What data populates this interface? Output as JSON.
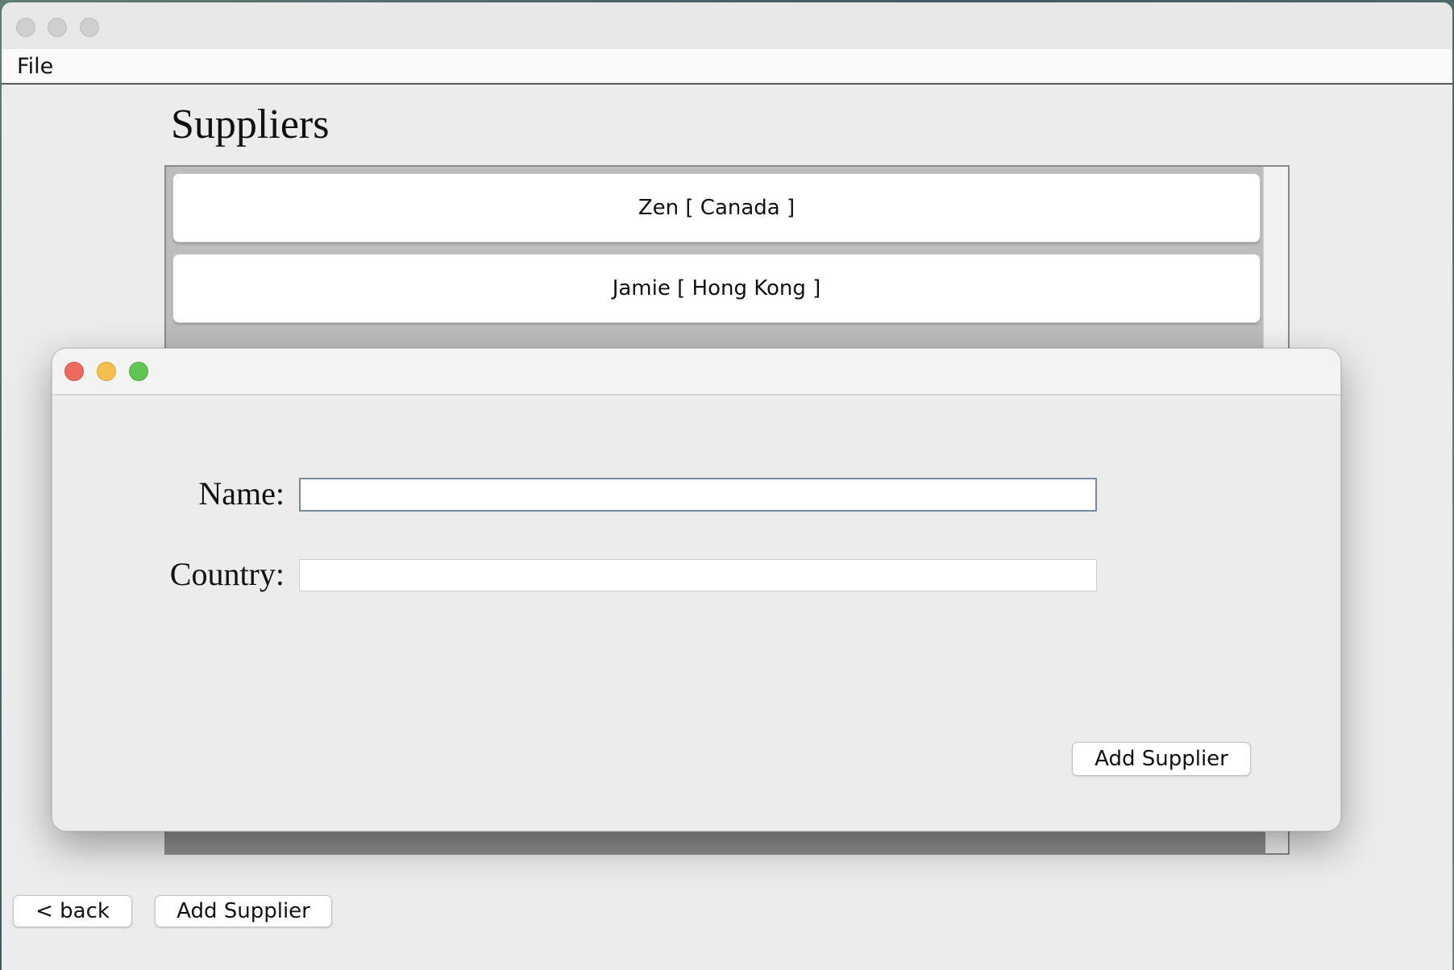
{
  "menu": {
    "file_label": "File"
  },
  "page": {
    "title": "Suppliers"
  },
  "suppliers": [
    {
      "label": "Zen [ Canada ]"
    },
    {
      "label": "Jamie [ Hong Kong ]"
    }
  ],
  "bottom_bar": {
    "back_label": "< back",
    "add_label": "Add Supplier"
  },
  "dialog": {
    "name_label": "Name:",
    "name_value": "",
    "country_label": "Country:",
    "country_value": "",
    "submit_label": "Add Supplier"
  },
  "colors": {
    "close": "#ec6a5e",
    "minimize": "#f4bf4f",
    "maximize": "#61c554"
  }
}
